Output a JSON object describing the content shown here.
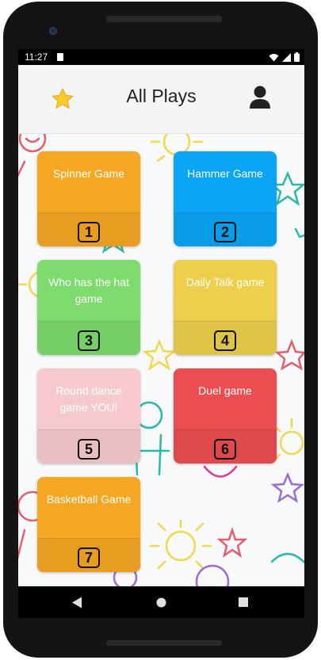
{
  "status_bar": {
    "time": "11:27"
  },
  "header": {
    "title": "All Plays",
    "favorites_icon": "star-icon",
    "profile_icon": "user-icon"
  },
  "plays": [
    {
      "title": "Spinner Game",
      "number": "1",
      "color": "#F5A623"
    },
    {
      "title": "Hammer Game",
      "number": "2",
      "color": "#0AA5F5"
    },
    {
      "title": "Who has the hat game",
      "number": "3",
      "color": "#7EDB6D"
    },
    {
      "title": "Daily Talk game",
      "number": "4",
      "color": "#EDCF4C"
    },
    {
      "title": "Round dance game YOU!",
      "number": "5",
      "color": "#F6CACD"
    },
    {
      "title": "Duel game",
      "number": "6",
      "color": "#EA4E50"
    },
    {
      "title": "Basketball Game",
      "number": "7",
      "color": "#F5A623"
    }
  ],
  "nav_icons": [
    "back-icon",
    "home-icon",
    "recents-icon"
  ]
}
